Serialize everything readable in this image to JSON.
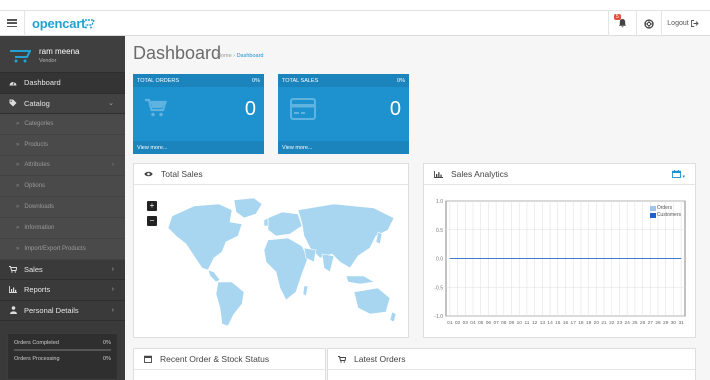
{
  "topbar": {
    "logo_text": "opencart",
    "notification_count": "5",
    "logout_label": "Logout"
  },
  "sidebar": {
    "user_name": "ram meena",
    "user_role": "Vendor",
    "items": [
      {
        "label": "Dashboard",
        "icon": "dashboard-icon"
      },
      {
        "label": "Catalog",
        "icon": "tag-icon"
      },
      {
        "label": "Categories"
      },
      {
        "label": "Products"
      },
      {
        "label": "Attributes"
      },
      {
        "label": "Options"
      },
      {
        "label": "Downloads"
      },
      {
        "label": "Information"
      },
      {
        "label": "Import/Export Products"
      },
      {
        "label": "Sales",
        "icon": "cart-icon"
      },
      {
        "label": "Reports",
        "icon": "bar-chart-icon"
      },
      {
        "label": "Personal Details",
        "icon": "user-icon"
      }
    ],
    "stats": [
      {
        "label": "Orders Completed",
        "value": "0%",
        "fraction": 0
      },
      {
        "label": "Orders Processing",
        "value": "0%",
        "fraction": 0
      }
    ]
  },
  "main": {
    "title": "Dashboard",
    "breadcrumb": {
      "home": "Home",
      "separator": "›",
      "current": "Dashboard"
    },
    "tiles": [
      {
        "label": "TOTAL ORDERS",
        "percent": "0%",
        "value": "0",
        "link": "View more...",
        "icon": "cart-icon"
      },
      {
        "label": "TOTAL SALES",
        "percent": "0%",
        "value": "0",
        "link": "View more...",
        "icon": "credit-card-icon"
      }
    ],
    "map_panel": {
      "title": "Total Sales",
      "zoom_in": "+",
      "zoom_out": "−"
    },
    "analytics_panel": {
      "title": "Sales Analytics"
    },
    "recent_panel": {
      "title": "Recent Order & Stock Status"
    },
    "latest_panel": {
      "title": "Latest Orders"
    }
  },
  "chart_data": {
    "type": "line",
    "x": [
      "01",
      "02",
      "03",
      "04",
      "05",
      "06",
      "07",
      "08",
      "09",
      "10",
      "11",
      "12",
      "13",
      "14",
      "15",
      "16",
      "17",
      "18",
      "19",
      "20",
      "21",
      "22",
      "23",
      "24",
      "25",
      "26",
      "27",
      "28",
      "29",
      "30",
      "31"
    ],
    "series": [
      {
        "name": "Orders",
        "values": [
          0,
          0,
          0,
          0,
          0,
          0,
          0,
          0,
          0,
          0,
          0,
          0,
          0,
          0,
          0,
          0,
          0,
          0,
          0,
          0,
          0,
          0,
          0,
          0,
          0,
          0,
          0,
          0,
          0,
          0,
          0
        ],
        "color": "#9fc5e8"
      },
      {
        "name": "Customers",
        "values": [
          0,
          0,
          0,
          0,
          0,
          0,
          0,
          0,
          0,
          0,
          0,
          0,
          0,
          0,
          0,
          0,
          0,
          0,
          0,
          0,
          0,
          0,
          0,
          0,
          0,
          0,
          0,
          0,
          0,
          0,
          0
        ],
        "color": "#1f5fd1"
      }
    ],
    "yticks": [
      "1.0",
      "0.5",
      "0.0",
      "-0.5",
      "-1.0"
    ],
    "ylim": [
      -1,
      1
    ],
    "grid": true,
    "legend_position": "top-right"
  },
  "colors": {
    "accent": "#1e91cf",
    "sidebar": "#3a3a3a",
    "map_land": "#a8d6f0"
  }
}
